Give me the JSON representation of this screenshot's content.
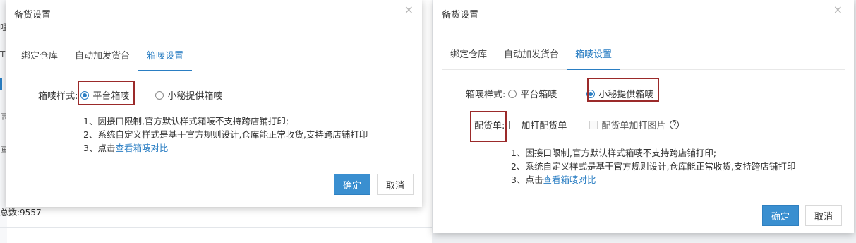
{
  "background": {
    "side_chars": [
      "哩",
      "T",
      "同",
      "画"
    ],
    "total_label": "总数:9557"
  },
  "dialog_left": {
    "title": "备货设置",
    "close_glyph": "×",
    "tabs": [
      "绑定仓库",
      "自动加发货台",
      "箱唛设置"
    ],
    "active_tab": 2,
    "label_style": "箱唛样式:",
    "option_platform": "平台箱唛",
    "option_xiaomi": "小秘提供箱唛",
    "selected": "platform",
    "notes": {
      "line1": "1、因接口限制,官方默认样式箱唛不支持跨店铺打印;",
      "line2": "2、系统自定义样式是基于官方规则设计,仓库能正常收货,支持跨店铺打印",
      "line3_prefix": "3、点击",
      "line3_link": "查看箱唛对比"
    },
    "ok": "确定",
    "cancel": "取消"
  },
  "dialog_right": {
    "title": "备货设置",
    "close_glyph": "×",
    "tabs": [
      "绑定仓库",
      "自动加发货台",
      "箱唛设置"
    ],
    "active_tab": 2,
    "label_style": "箱唛样式:",
    "option_platform": "平台箱唛",
    "option_xiaomi": "小秘提供箱唛",
    "selected": "xiaomi",
    "label_packing": "配货单:",
    "checkbox_print": "加打配货单",
    "checkbox_image": "配货单加打图片",
    "help_glyph": "?",
    "notes": {
      "line1": "1、因接口限制,官方默认样式箱唛不支持跨店铺打印;",
      "line2": "2、系统自定义样式是基于官方规则设计,仓库能正常收货,支持跨店铺打印",
      "line3_prefix": "3、点击",
      "line3_link": "查看箱唛对比"
    },
    "ok": "确定",
    "cancel": "取消"
  },
  "colors": {
    "accent": "#2a7ec3",
    "primary_button": "#3a8fd0",
    "highlight_box": "#9b2a2a"
  }
}
